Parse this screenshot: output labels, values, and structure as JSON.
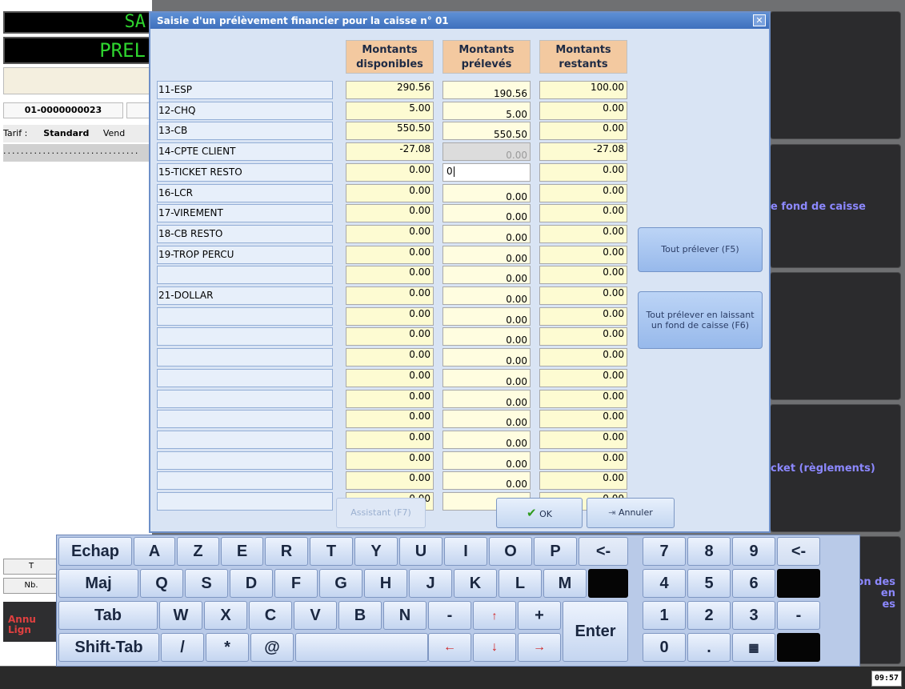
{
  "background": {
    "lcd_line1": "SA",
    "lcd_line2": "PREL",
    "ticket_number": "01-0000000023",
    "tarif_label": "Tarif :",
    "tarif_value": "Standard",
    "vendeur_label": "Vend",
    "dotted_line": "...............................",
    "small_btn_1": "T",
    "small_btn_2": "Nb.",
    "annul_label_1": "Annu",
    "annul_label_2": "Lign",
    "right_panel_2": "e fond de caisse",
    "right_panel_4": "cket (règlements)",
    "right_panel_5_line1": "on des",
    "right_panel_5_line2": "en",
    "right_panel_5_line3": "es",
    "clock": "09:57"
  },
  "dialog": {
    "title": "Saisie d'un prélèvement financier pour la caisse n° 01",
    "close_glyph": "✕",
    "columns": {
      "disponibles_1": "Montants",
      "disponibles_2": "disponibles",
      "preleves_1": "Montants",
      "preleves_2": "prélevés",
      "restants_1": "Montants",
      "restants_2": "restants"
    },
    "rows": [
      {
        "label": "11-ESP",
        "dispo": "290.56",
        "preleve": "190.56",
        "restant": "100.00"
      },
      {
        "label": "12-CHQ",
        "dispo": "5.00",
        "preleve": "5.00",
        "restant": "0.00"
      },
      {
        "label": "13-CB",
        "dispo": "550.50",
        "preleve": "550.50",
        "restant": "0.00"
      },
      {
        "label": "14-CPTE CLIENT",
        "dispo": "-27.08",
        "preleve": "0.00",
        "restant": "-27.08"
      },
      {
        "label": "15-TICKET RESTO",
        "dispo": "0.00",
        "preleve": "0",
        "restant": "0.00"
      },
      {
        "label": "16-LCR",
        "dispo": "0.00",
        "preleve": "0.00",
        "restant": "0.00"
      },
      {
        "label": "17-VIREMENT",
        "dispo": "0.00",
        "preleve": "0.00",
        "restant": "0.00"
      },
      {
        "label": "18-CB RESTO",
        "dispo": "0.00",
        "preleve": "0.00",
        "restant": "0.00"
      },
      {
        "label": "19-TROP PERCU",
        "dispo": "0.00",
        "preleve": "0.00",
        "restant": "0.00"
      },
      {
        "label": "",
        "dispo": "0.00",
        "preleve": "0.00",
        "restant": "0.00"
      },
      {
        "label": "21-DOLLAR",
        "dispo": "0.00",
        "preleve": "0.00",
        "restant": "0.00"
      },
      {
        "label": "",
        "dispo": "0.00",
        "preleve": "0.00",
        "restant": "0.00"
      },
      {
        "label": "",
        "dispo": "0.00",
        "preleve": "0.00",
        "restant": "0.00"
      },
      {
        "label": "",
        "dispo": "0.00",
        "preleve": "0.00",
        "restant": "0.00"
      },
      {
        "label": "",
        "dispo": "0.00",
        "preleve": "0.00",
        "restant": "0.00"
      },
      {
        "label": "",
        "dispo": "0.00",
        "preleve": "0.00",
        "restant": "0.00"
      },
      {
        "label": "",
        "dispo": "0.00",
        "preleve": "0.00",
        "restant": "0.00"
      },
      {
        "label": "",
        "dispo": "0.00",
        "preleve": "0.00",
        "restant": "0.00"
      },
      {
        "label": "",
        "dispo": "0.00",
        "preleve": "0.00",
        "restant": "0.00"
      },
      {
        "label": "",
        "dispo": "0.00",
        "preleve": "0.00",
        "restant": "0.00"
      },
      {
        "label": "",
        "dispo": "0.00",
        "preleve": "0.00",
        "restant": "0.00"
      }
    ],
    "buttons": {
      "tout_prelever": "Tout prélever (F5)",
      "tout_prelever_fond_1": "Tout prélever en laissant",
      "tout_prelever_fond_2": "un fond de caisse (F6)",
      "assistant": "Assistant (F7)",
      "ok": "OK",
      "ok_icon": "✔",
      "annuler": "Annuler",
      "annuler_icon": "⇥"
    }
  },
  "keyboard": {
    "row1": [
      "Echap",
      "A",
      "Z",
      "E",
      "R",
      "T",
      "Y",
      "U",
      "I",
      "O",
      "P",
      "<-"
    ],
    "row2": [
      "Maj",
      "Q",
      "S",
      "D",
      "F",
      "G",
      "H",
      "J",
      "K",
      "L",
      "M"
    ],
    "row3": [
      "Tab",
      "W",
      "X",
      "C",
      "V",
      "B",
      "N",
      "-",
      "↑",
      "+"
    ],
    "row4": [
      "Shift-Tab",
      "/",
      "*",
      "@"
    ],
    "arrows": {
      "left": "←",
      "down": "↓",
      "right": "→"
    },
    "enter": "Enter",
    "numpad": {
      "r1": [
        "7",
        "8",
        "9",
        "<-"
      ],
      "r2": [
        "4",
        "5",
        "6"
      ],
      "r3": [
        "1",
        "2",
        "3",
        "-"
      ],
      "r4": [
        "0",
        ".",
        "▦"
      ]
    }
  }
}
